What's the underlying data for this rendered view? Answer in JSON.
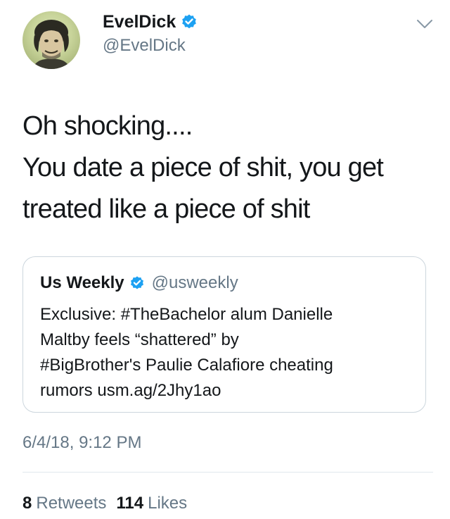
{
  "colors": {
    "verified": "#1da1f2",
    "secondary_text": "#657786",
    "primary_text": "#14171a",
    "border": "#ccd6dd"
  },
  "header": {
    "display_name": "EvelDick",
    "handle": "@EvelDick",
    "verified_icon": "verified-badge-icon",
    "menu_icon": "chevron-down-icon",
    "avatar": "profile-avatar"
  },
  "tweet": {
    "lines": [
      "Oh shocking....",
      "You date a piece of shit, you get",
      "treated like a piece of shit"
    ]
  },
  "quoted_tweet": {
    "display_name": "Us Weekly",
    "handle": "@usweekly",
    "verified_icon": "verified-badge-icon",
    "lines": [
      "Exclusive: #TheBachelor alum Danielle",
      "Maltby feels “shattered” by",
      "#BigBrother's Paulie Calafiore cheating",
      "rumors usm.ag/2Jhy1ao"
    ]
  },
  "timestamp": "6/4/18, 9:12 PM",
  "stats": {
    "retweets_count": "8",
    "retweets_label": "Retweets",
    "likes_count": "114",
    "likes_label": "Likes"
  }
}
